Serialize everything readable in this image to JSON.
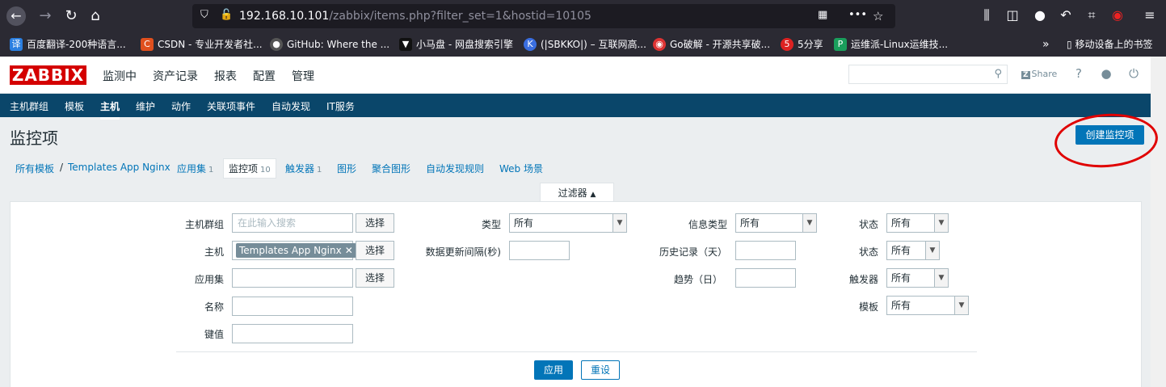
{
  "browser": {
    "url_host": "192.168.10.101",
    "url_path": "/zabbix/items.php?filter_set=1&hostid=10105",
    "bookmarks": [
      {
        "label": "百度翻译-200种语言...",
        "icon": "译",
        "color": "#2b7fe0"
      },
      {
        "label": "CSDN - 专业开发者社...",
        "icon": "C",
        "color": "#e0501e"
      },
      {
        "label": "GitHub: Where the ...",
        "icon": "●",
        "color": "#555"
      },
      {
        "label": "小马盘 - 网盘搜索引擎",
        "icon": "▼",
        "color": "#111"
      },
      {
        "label": "(|SBKKO|) – 互联网高...",
        "icon": "K",
        "color": "#3a6ee0"
      },
      {
        "label": "Go破解 - 开源共享破...",
        "icon": "◉",
        "color": "#d33"
      },
      {
        "label": "5分享",
        "icon": "5",
        "color": "#d22"
      },
      {
        "label": "运维派-Linux运维技...",
        "icon": "P",
        "color": "#1a9e5c"
      }
    ],
    "mobile_bookmarks": "移动设备上的书签"
  },
  "header": {
    "logo": "ZABBIX",
    "menu": [
      "监测中",
      "资产记录",
      "报表",
      "配置",
      "管理"
    ],
    "share": "Share"
  },
  "submenu": [
    "主机群组",
    "模板",
    "主机",
    "维护",
    "动作",
    "关联项事件",
    "自动发现",
    "IT服务"
  ],
  "page": {
    "title": "监控项",
    "create_button": "创建监控项"
  },
  "breadcrumbs": {
    "all_templates": "所有模板",
    "separator": "/",
    "template": "Templates App Nginx",
    "tabs": [
      {
        "label": "应用集",
        "count": "1"
      },
      {
        "label": "监控项",
        "count": "10"
      },
      {
        "label": "触发器",
        "count": "1"
      },
      {
        "label": "图形",
        "count": ""
      },
      {
        "label": "聚合图形",
        "count": ""
      },
      {
        "label": "自动发现规则",
        "count": ""
      },
      {
        "label": "Web 场景",
        "count": ""
      }
    ]
  },
  "filter": {
    "tab_label": "过滤器",
    "host_group_label": "主机群组",
    "host_group_placeholder": "在此输入搜索",
    "select_label": "选择",
    "host_label": "主机",
    "host_chip": "Templates App Nginx",
    "application_label": "应用集",
    "name_label": "名称",
    "key_label": "键值",
    "type_label": "类型",
    "type_value": "所有",
    "interval_label": "数据更新间隔(秒)",
    "info_type_label": "信息类型",
    "info_type_value": "所有",
    "history_label": "历史记录（天）",
    "trends_label": "趋势（日）",
    "state_label": "状态",
    "state_value": "所有",
    "status_label": "状态",
    "status_value": "所有",
    "triggers_label": "触发器",
    "triggers_value": "所有",
    "template_label": "模板",
    "template_value": "所有",
    "apply": "应用",
    "reset": "重设"
  }
}
